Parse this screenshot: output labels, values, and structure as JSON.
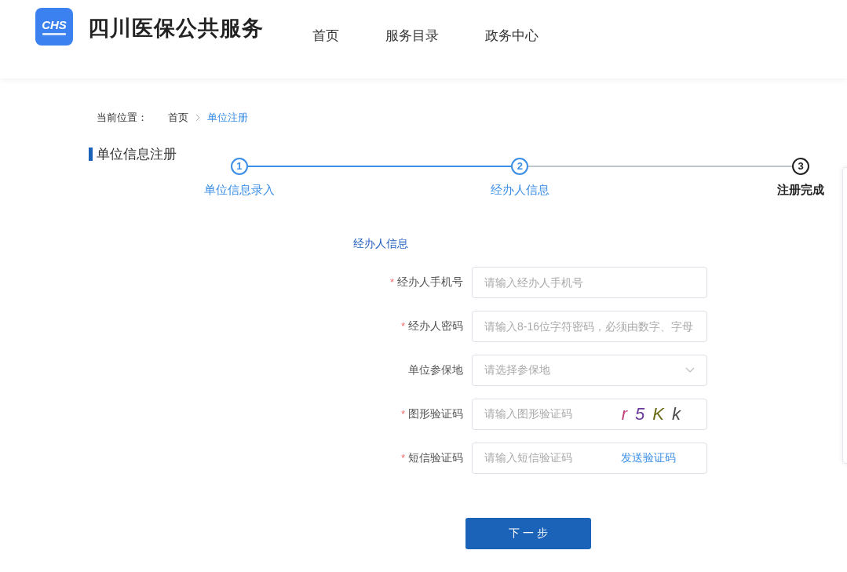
{
  "header": {
    "logo_text": "CHS",
    "site_title": "四川医保公共服务",
    "nav": [
      {
        "label": "首页",
        "selected": false
      },
      {
        "label": "服务目录",
        "selected": false
      },
      {
        "label": "政务中心",
        "selected": false
      }
    ]
  },
  "breadcrumb": {
    "label": "当前位置：",
    "items": [
      {
        "label": "首页",
        "selected": false
      },
      {
        "label": "单位注册",
        "selected": true
      }
    ]
  },
  "page_title": "单位信息注册",
  "steps": [
    {
      "number": "1",
      "label": "单位信息录入",
      "completed": true,
      "current": false
    },
    {
      "number": "2",
      "label": "经办人信息",
      "completed": true,
      "current": false
    },
    {
      "number": "3",
      "label": "注册完成",
      "completed": false,
      "current": true
    }
  ],
  "form": {
    "section_title": "经办人信息",
    "fields": [
      {
        "kind": "text",
        "label": "经办人手机号",
        "required_mark": "*",
        "placeholder": "请输入经办人手机号"
      },
      {
        "kind": "text",
        "label": "经办人密码",
        "required_mark": "*",
        "placeholder": "请输入8-16位字符密码，必须由数字、字母"
      },
      {
        "kind": "select",
        "label": "单位参保地",
        "placeholder": "请选择参保地"
      },
      {
        "kind": "captcha",
        "label": "图形验证码",
        "required_mark": "*",
        "placeholder": "请输入图形验证码",
        "captcha": [
          {
            "char": "r",
            "color": "#c0407a"
          },
          {
            "char": "5",
            "color": "#6a3a9a"
          },
          {
            "char": "K",
            "color": "#6b6b1a"
          },
          {
            "char": "k",
            "color": "#4a4a4a"
          }
        ]
      },
      {
        "kind": "sms",
        "label": "短信验证码",
        "required_mark": "*",
        "placeholder": "请输入短信验证码",
        "action": "发送验证码"
      }
    ],
    "submit": "下 一 步"
  }
}
